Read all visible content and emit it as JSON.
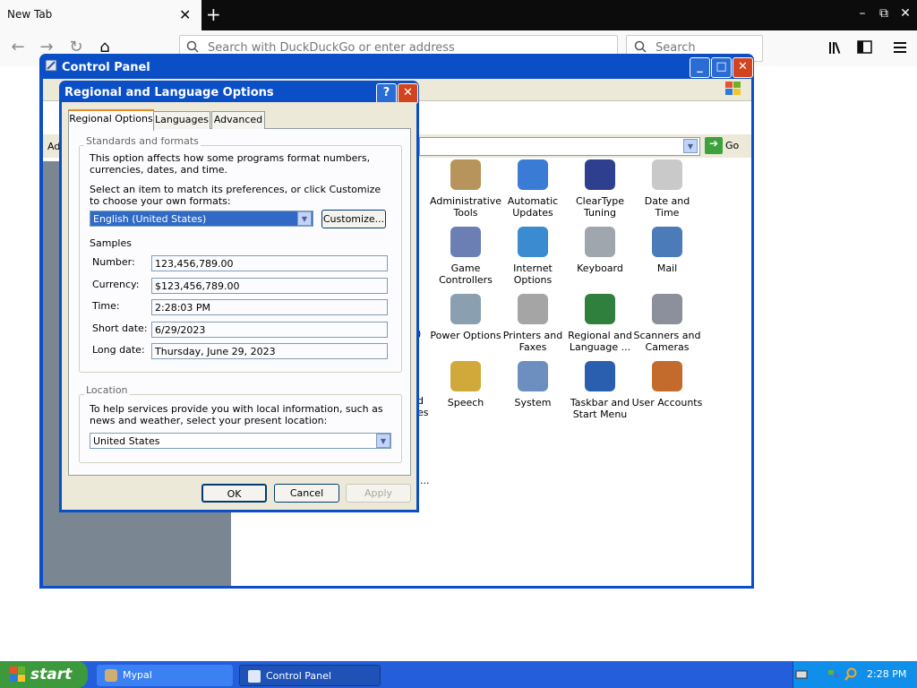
{
  "browser": {
    "tab_title": "New Tab",
    "close_tab_glyph": "✕",
    "new_tab_glyph": "+",
    "back_glyph": "←",
    "forward_glyph": "→",
    "reload_glyph": "↻",
    "home_glyph": "⌂",
    "url_placeholder": "Search with DuckDuckGo or enter address",
    "search_placeholder": "Search",
    "window_controls": [
      "–",
      "⧉",
      "✕"
    ],
    "toolbar_icons": [
      "library-icon",
      "sidebar-icon",
      "menu-icon"
    ]
  },
  "control_panel": {
    "title": "Control Panel",
    "controls": [
      "_",
      "□",
      "✕"
    ],
    "go_label": "Go",
    "side_text": "Ad",
    "truncated_text": "...",
    "partial_labels": [
      "d",
      "es"
    ],
    "items": [
      {
        "label": "Administrative Tools",
        "icon": "admin-tools-icon",
        "color": "#b7945b"
      },
      {
        "label": "Automatic Updates",
        "icon": "automatic-updates-icon",
        "color": "#3a7bd5"
      },
      {
        "label": "ClearType Tuning",
        "icon": "cleartype-icon",
        "color": "#2e3f8f"
      },
      {
        "label": "Date and Time",
        "icon": "date-time-icon",
        "color": "#c9c9c9"
      },
      {
        "label": "Game Controllers",
        "icon": "game-controllers-icon",
        "color": "#6b7fb5"
      },
      {
        "label": "Internet Options",
        "icon": "internet-options-icon",
        "color": "#3b8bd1"
      },
      {
        "label": "Keyboard",
        "icon": "keyboard-icon",
        "color": "#9fa6ad"
      },
      {
        "label": "Mail",
        "icon": "mail-icon",
        "color": "#4b7bb8"
      },
      {
        "label": "Power Options",
        "icon": "power-options-icon",
        "color": "#8a9fb0"
      },
      {
        "label": "Printers and Faxes",
        "icon": "printers-faxes-icon",
        "color": "#a5a5a5"
      },
      {
        "label": "Regional and Language ...",
        "icon": "globe-icon",
        "color": "#2f7f3d"
      },
      {
        "label": "Scanners and Cameras",
        "icon": "scanners-cameras-icon",
        "color": "#8c8f9c"
      },
      {
        "label": "Speech",
        "icon": "speech-icon",
        "color": "#d1a93a"
      },
      {
        "label": "System",
        "icon": "system-icon",
        "color": "#6d8fc0"
      },
      {
        "label": "Taskbar and Start Menu",
        "icon": "taskbar-startmenu-icon",
        "color": "#2a5fb0"
      },
      {
        "label": "User Accounts",
        "icon": "user-accounts-icon",
        "color": "#c36b2c"
      }
    ]
  },
  "dialog": {
    "title": "Regional and Language Options",
    "help_glyph": "?",
    "close_glyph": "✕",
    "tabs": [
      "Regional Options",
      "Languages",
      "Advanced"
    ],
    "standards": {
      "group_title": "Standards and formats",
      "description": "This option affects how some programs format numbers, currencies, dates, and time.",
      "select_prompt": "Select an item to match its preferences, or click Customize to choose your own formats:",
      "selected_format": "English (United States)",
      "customize_label": "Customize...",
      "samples_title": "Samples",
      "samples": [
        {
          "label": "Number:",
          "value": "123,456,789.00"
        },
        {
          "label": "Currency:",
          "value": "$123,456,789.00"
        },
        {
          "label": "Time:",
          "value": "2:28:03 PM"
        },
        {
          "label": "Short date:",
          "value": "6/29/2023"
        },
        {
          "label": "Long date:",
          "value": "Thursday, June 29, 2023"
        }
      ]
    },
    "location": {
      "group_title": "Location",
      "description": "To help services provide you with local information, such as news and weather, select your present location:",
      "selected": "United States"
    },
    "buttons": {
      "ok": "OK",
      "cancel": "Cancel",
      "apply": "Apply"
    }
  },
  "taskbar": {
    "start_label": "start",
    "tasks": [
      {
        "label": "Mypal",
        "active": false
      },
      {
        "label": "Control Panel",
        "active": true
      }
    ],
    "clock": "2:28 PM"
  }
}
